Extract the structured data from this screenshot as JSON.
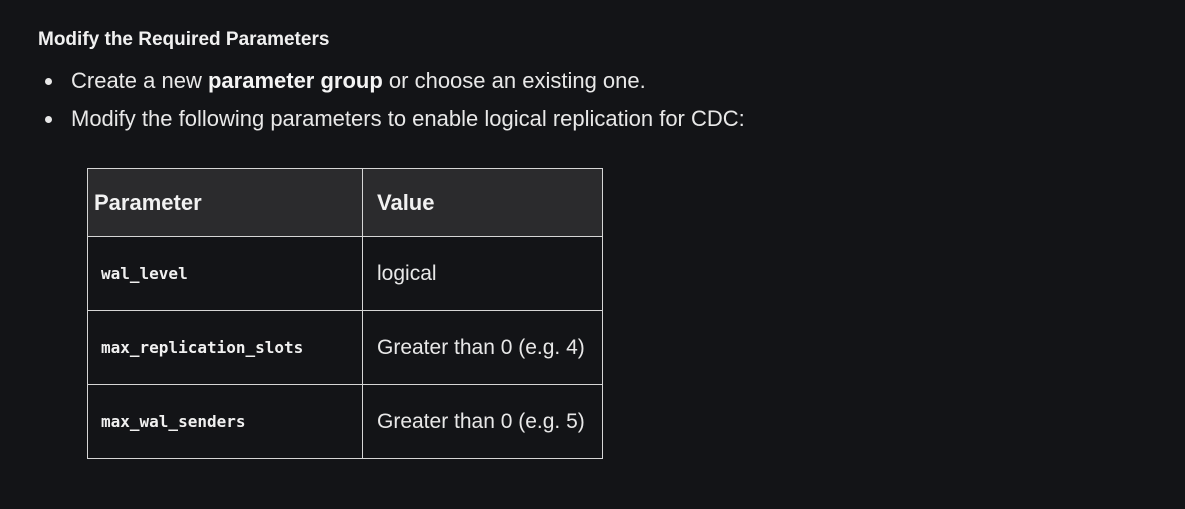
{
  "heading": "Modify the Required Parameters",
  "bullets": [
    {
      "pre": "Create a new ",
      "bold": "parameter group",
      "post": " or choose an existing one."
    },
    {
      "text": "Modify the following parameters to enable logical replication for CDC:"
    }
  ],
  "table": {
    "headers": [
      "Parameter",
      "Value"
    ],
    "rows": [
      {
        "parameter": "wal_level",
        "value": "logical"
      },
      {
        "parameter": "max_replication_slots",
        "value": "Greater than 0 (e.g. 4)"
      },
      {
        "parameter": "max_wal_senders",
        "value": "Greater than 0 (e.g. 5)"
      }
    ]
  },
  "colors": {
    "background": "#131417",
    "header_fill": "#2b2b2d",
    "border": "#d6d6d6",
    "text": "#e8e8e8"
  }
}
